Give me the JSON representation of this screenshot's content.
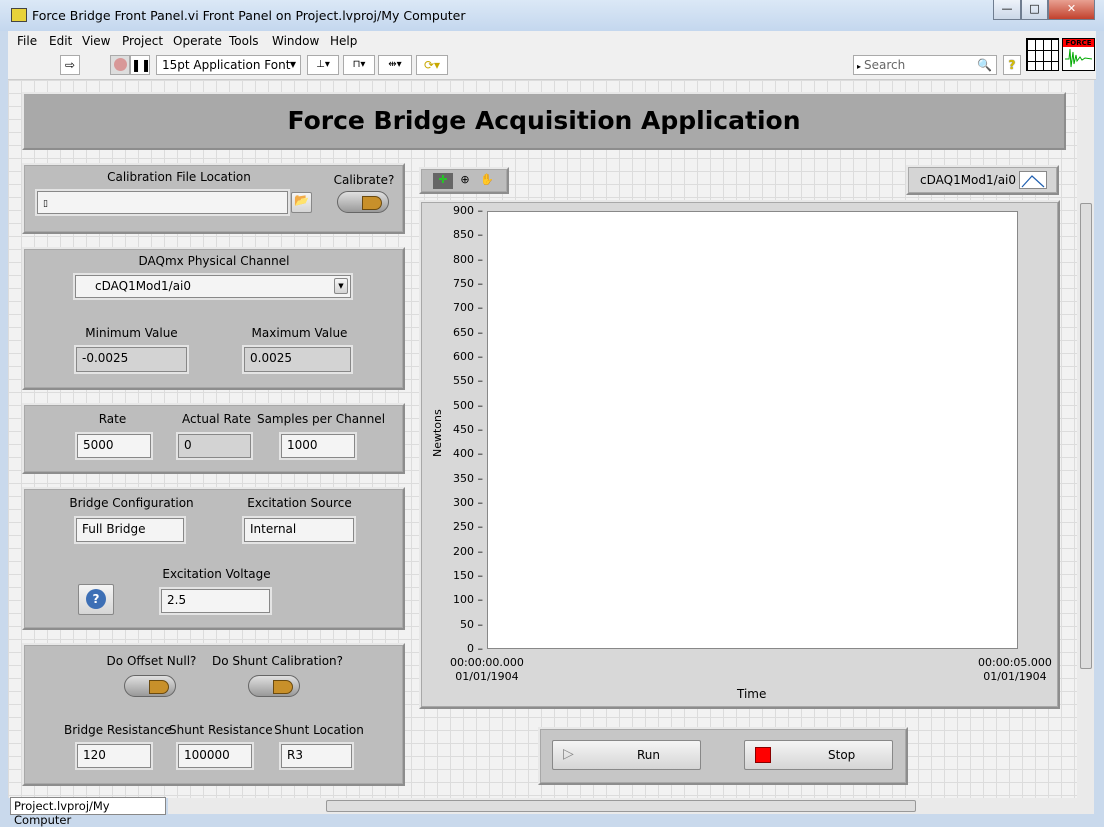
{
  "window": {
    "title": "Force Bridge Front Panel.vi Front Panel on Project.lvproj/My Computer",
    "minimize": "—",
    "maximize": "□",
    "close": "✕"
  },
  "menu": [
    "File",
    "Edit",
    "View",
    "Project",
    "Operate",
    "Tools",
    "Window",
    "Help"
  ],
  "toolbar": {
    "font": "15pt Application Font",
    "search_placeholder": "Search",
    "help": "?",
    "icon_label": "FORCE"
  },
  "header": {
    "title": "Force Bridge Acquisition Application"
  },
  "calibration": {
    "file_label": "Calibration File Location",
    "file_value": "",
    "calibrate_label": "Calibrate?",
    "calibrate_on": false
  },
  "channel": {
    "label": "DAQmx Physical Channel",
    "value": "cDAQ1Mod1/ai0",
    "min_label": "Minimum Value",
    "min_value": "-0.0025",
    "max_label": "Maximum Value",
    "max_value": "0.0025"
  },
  "timing": {
    "rate_label": "Rate",
    "rate_value": "5000",
    "actual_label": "Actual Rate",
    "actual_value": "0",
    "spc_label": "Samples per Channel",
    "spc_value": "1000"
  },
  "bridge": {
    "config_label": "Bridge Configuration",
    "config_value": "Full Bridge",
    "exc_src_label": "Excitation Source",
    "exc_src_value": "Internal",
    "exc_v_label": "Excitation Voltage",
    "exc_v_value": "2.5",
    "help": "?"
  },
  "calib2": {
    "offset_label": "Do Offset Null?",
    "offset_on": false,
    "shunt_label": "Do Shunt Calibration?",
    "shunt_on": false,
    "bridge_res_label": "Bridge Resistance",
    "bridge_res_value": "120",
    "shunt_res_label": "Shunt Resistance",
    "shunt_res_value": "100000",
    "shunt_loc_label": "Shunt Location",
    "shunt_loc_value": "R3"
  },
  "legend": {
    "series": "cDAQ1Mod1/ai0"
  },
  "chart_data": {
    "type": "line",
    "ylabel": "Newtons",
    "xlabel": "Time",
    "ylim": [
      0,
      900
    ],
    "ytick_step": 50,
    "xlim_labels": [
      [
        "00:00:00.000",
        "01/01/1904"
      ],
      [
        "00:00:05.000",
        "01/01/1904"
      ]
    ],
    "series": [
      {
        "name": "cDAQ1Mod1/ai0",
        "values": []
      }
    ],
    "grid": false
  },
  "controls": {
    "run": "Run",
    "stop": "Stop"
  },
  "status": {
    "context": "Project.lvproj/My Computer"
  },
  "colors": {
    "banner": "#a9a9a9",
    "stop": "#ff0000",
    "background": "#f2f2f2"
  }
}
